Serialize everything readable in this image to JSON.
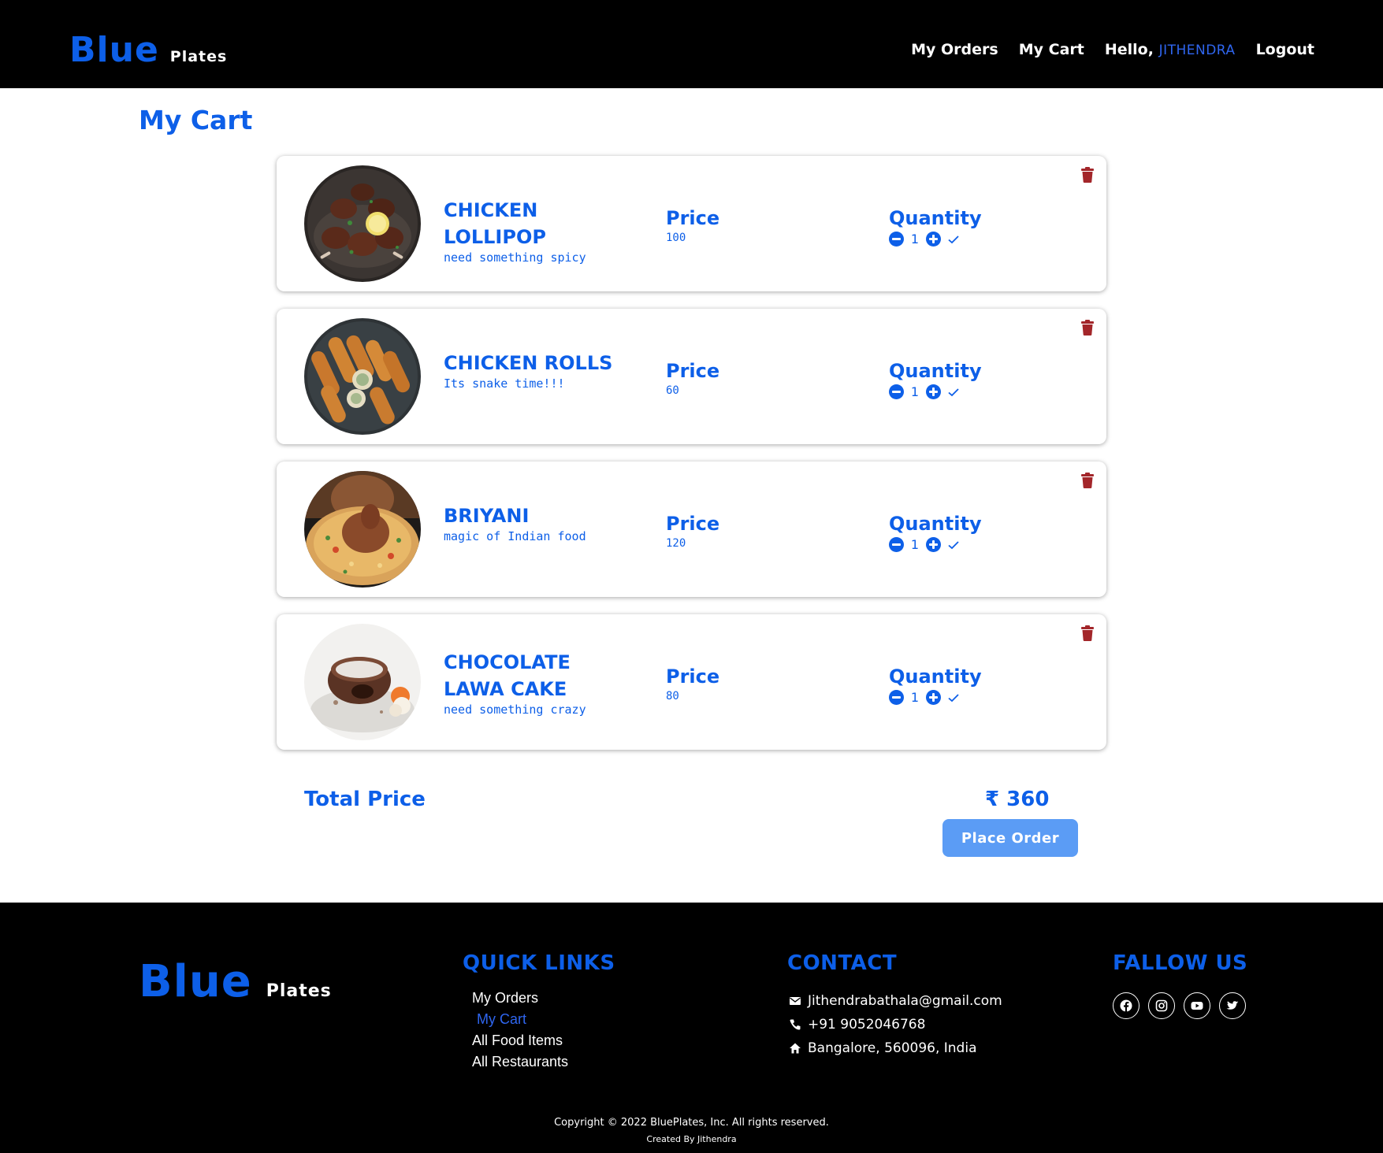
{
  "header": {
    "brand_main": "Blue",
    "brand_sub": "Plates",
    "nav": {
      "orders": "My Orders",
      "cart": "My Cart",
      "hello": "Hello, ",
      "username": "JITHENDRA",
      "logout": "Logout"
    }
  },
  "page": {
    "title": "My Cart"
  },
  "cart": {
    "price_label": "Price",
    "quantity_label": "Quantity",
    "items": [
      {
        "name": "CHICKEN LOLLIPOP",
        "description": "need something spicy",
        "price": "100",
        "quantity": "1",
        "image": "chicken-lollipop-photo"
      },
      {
        "name": "CHICKEN ROLLS",
        "description": "Its snake time!!!",
        "price": "60",
        "quantity": "1",
        "image": "chicken-rolls-photo"
      },
      {
        "name": "BRIYANI",
        "description": "magic of Indian food",
        "price": "120",
        "quantity": "1",
        "image": "briyani-photo"
      },
      {
        "name": "CHOCOLATE LAWA CAKE",
        "description": "need something crazy",
        "price": "80",
        "quantity": "1",
        "image": "chocolate-lava-cake-photo"
      }
    ],
    "total_label": "Total Price",
    "total_value": "₹ 360",
    "place_order": "Place Order"
  },
  "footer": {
    "brand_main": "Blue",
    "brand_sub": "Plates",
    "quick_links_title": "QUICK LINKS",
    "quick_links": [
      "My Orders",
      "My Cart",
      "All Food Items",
      "All Restaurants"
    ],
    "contact_title": "CONTACT",
    "contact": {
      "email": "Jithendrabathala@gmail.com",
      "phone": "+91 9052046768",
      "address": "Bangalore, 560096, India"
    },
    "follow_title": "FALLOW US",
    "socials": [
      "facebook-icon",
      "instagram-icon",
      "youtube-icon",
      "twitter-icon"
    ],
    "copyright": "Copyright © 2022 BluePlates, Inc. All rights reserved.",
    "created_by": "Created By Jithendra"
  },
  "colors": {
    "accent": "#0d5fe8",
    "button": "#5b9cf5",
    "trash": "#a3262a",
    "header_bg": "#000000"
  }
}
